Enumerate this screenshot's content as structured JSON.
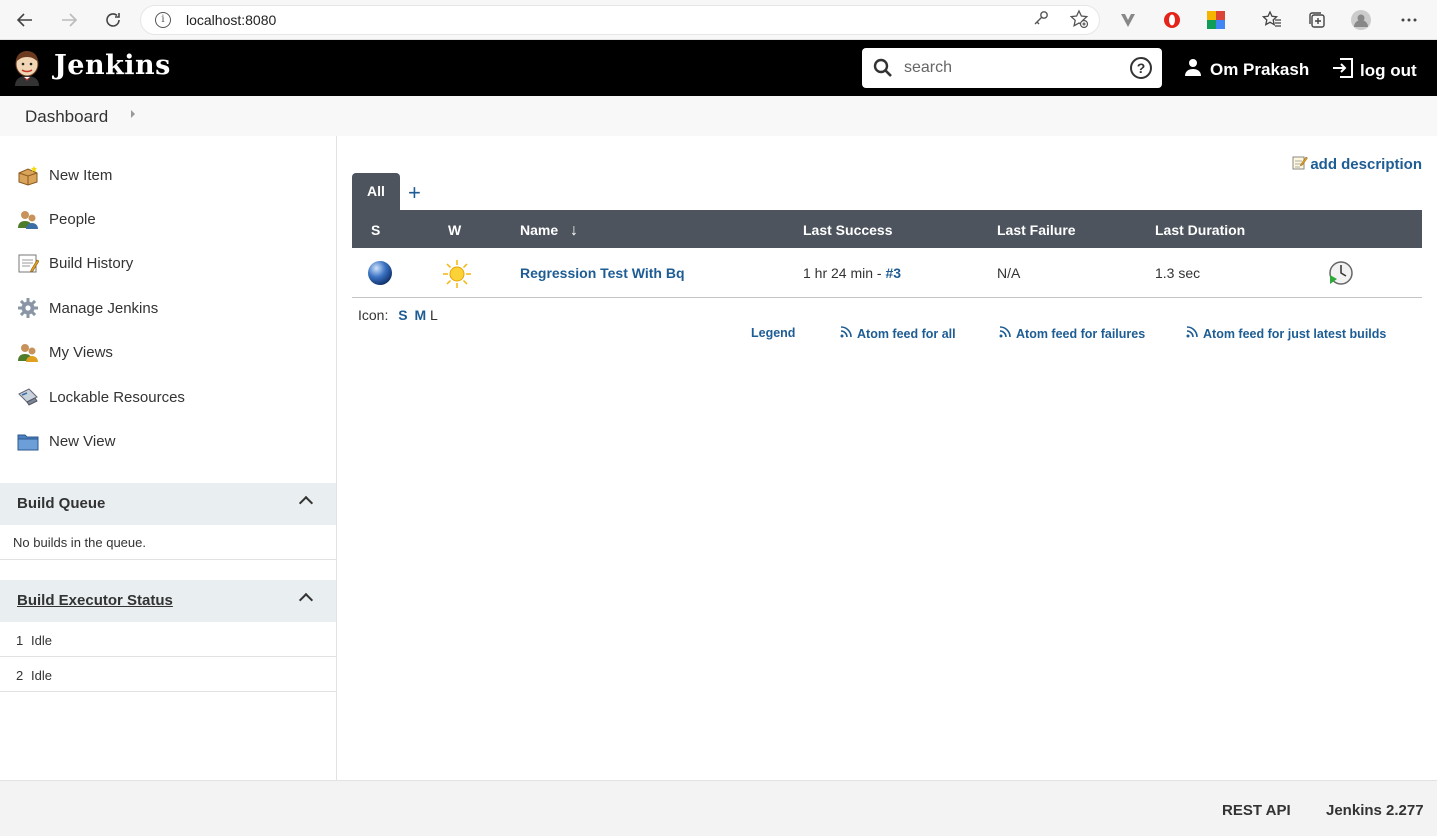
{
  "browser": {
    "url": "localhost:8080"
  },
  "header": {
    "app_name": "Jenkins",
    "search_placeholder": "search",
    "help_glyph": "?",
    "user_name": "Om Prakash",
    "logout_label": "log out"
  },
  "breadcrumb": {
    "items": [
      "Dashboard"
    ]
  },
  "sidebar": {
    "tasks": [
      {
        "label": "New Item",
        "icon": "new-item-icon"
      },
      {
        "label": "People",
        "icon": "people-icon"
      },
      {
        "label": "Build History",
        "icon": "build-history-icon"
      },
      {
        "label": "Manage Jenkins",
        "icon": "gear-icon"
      },
      {
        "label": "My Views",
        "icon": "user-views-icon"
      },
      {
        "label": "Lockable Resources",
        "icon": "lockable-resources-icon"
      },
      {
        "label": "New View",
        "icon": "folder-icon"
      }
    ],
    "build_queue": {
      "title": "Build Queue",
      "empty_text": "No builds in the queue."
    },
    "executors": {
      "title": "Build Executor Status",
      "rows": [
        {
          "num": "1",
          "status": "Idle"
        },
        {
          "num": "2",
          "status": "Idle"
        }
      ]
    }
  },
  "main": {
    "add_description": "add description",
    "tabs": [
      {
        "label": "All",
        "active": true
      }
    ],
    "add_tab": "+",
    "table": {
      "headers": {
        "s": "S",
        "w": "W",
        "name": "Name",
        "sort_arrow": "↓",
        "last_success": "Last Success",
        "last_failure": "Last Failure",
        "last_duration": "Last Duration"
      },
      "rows": [
        {
          "status": "success-blue-ball",
          "weather": "sunny",
          "name": "Regression Test With Bq",
          "last_success_time": "1 hr 24 min - ",
          "last_success_build": "#3",
          "last_failure": "N/A",
          "last_duration": "1.3 sec"
        }
      ]
    },
    "icon_size": {
      "label": "Icon:",
      "s": "S",
      "m": "M",
      "l": "L"
    },
    "feeds": {
      "legend": "Legend",
      "all": "Atom feed for all",
      "failures": "Atom feed for failures",
      "latest": "Atom feed for just latest builds"
    }
  },
  "footer": {
    "rest_api": "REST API",
    "version": "Jenkins 2.277"
  },
  "colors": {
    "header_bg": "#000000",
    "table_header_bg": "#4d545d",
    "link": "#1e5d94",
    "pane_header_bg": "#e9eef0"
  }
}
